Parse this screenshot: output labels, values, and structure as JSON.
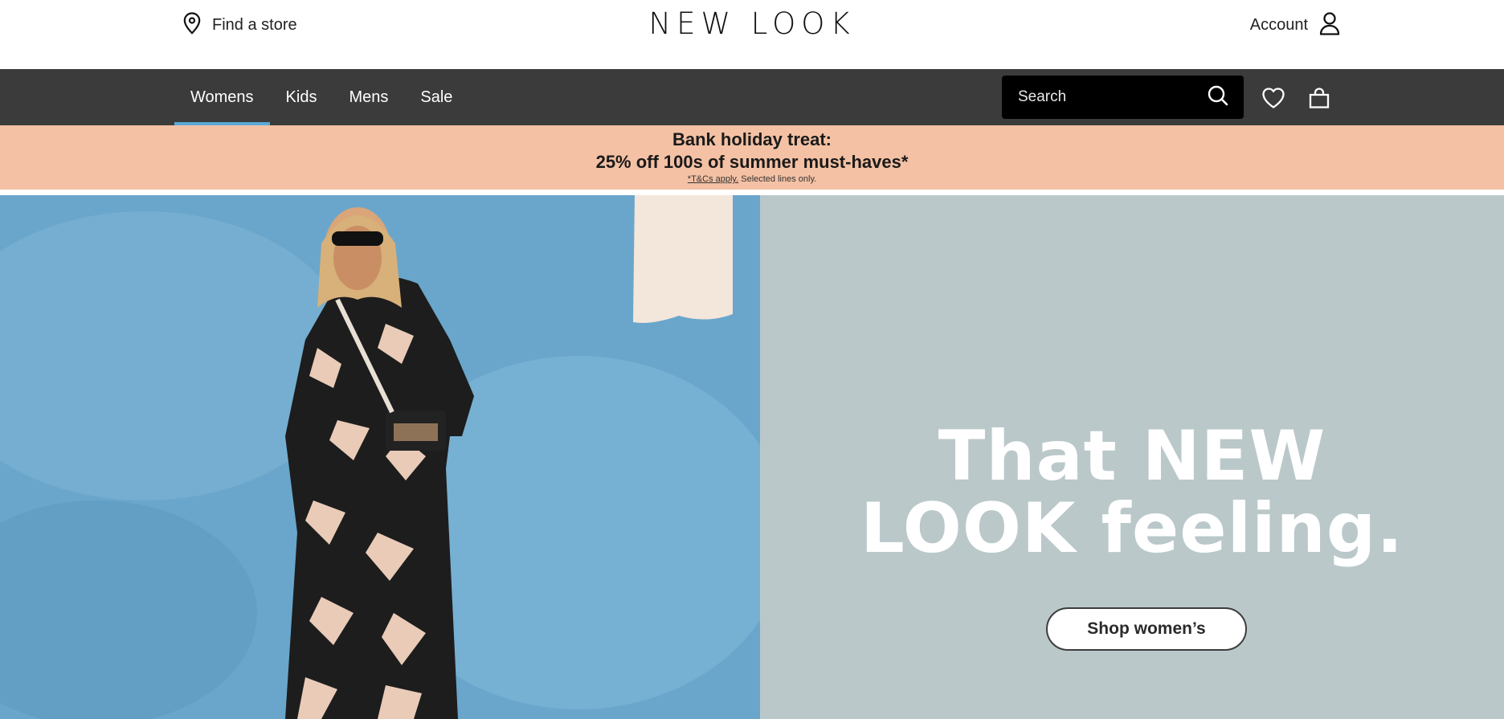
{
  "header": {
    "find_store_label": "Find a store",
    "logo_text": "NEW LOOK",
    "account_label": "Account"
  },
  "nav": {
    "tabs": [
      {
        "label": "Womens",
        "active": true
      },
      {
        "label": "Kids",
        "active": false
      },
      {
        "label": "Mens",
        "active": false
      },
      {
        "label": "Sale",
        "active": false
      }
    ],
    "search_placeholder": "Search",
    "icons": [
      "search-icon",
      "heart-icon",
      "bag-icon"
    ]
  },
  "promo": {
    "line1": "Bank holiday treat:",
    "line2": "25% off 100s of summer must-haves*",
    "tc_link": "*T&Cs apply.",
    "tc_text": "Selected lines only."
  },
  "hero": {
    "headline_line1": "That NEW",
    "headline_line2": "LOOK feeling.",
    "cta_label": "Shop women’s"
  },
  "colors": {
    "nav_bg": "#3b3b3b",
    "active_tab_underline": "#5aa9d6",
    "promo_bg": "#f4c1a4",
    "hero_right_bg": "#bac8ca",
    "search_bg": "#000000"
  }
}
